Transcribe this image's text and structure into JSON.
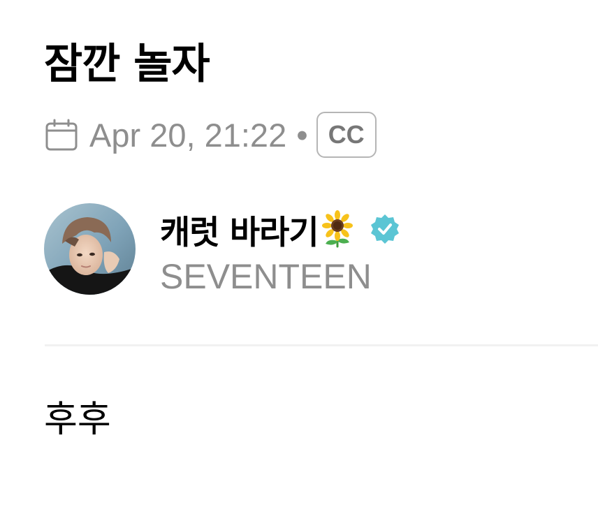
{
  "post": {
    "title": "잠깐 놀자",
    "date": "Apr 20, 21:22",
    "separator": "•",
    "cc_badge": "CC",
    "body": "후후"
  },
  "author": {
    "name": "캐럿 바라기",
    "group": "SEVENTEEN",
    "name_emoji": "sunflower-icon",
    "verified": true
  },
  "colors": {
    "meta_text": "#8e8e8e",
    "verified_badge": "#5bc5d4",
    "divider": "#f1f1f1",
    "cc_border": "#b5b5b5"
  }
}
